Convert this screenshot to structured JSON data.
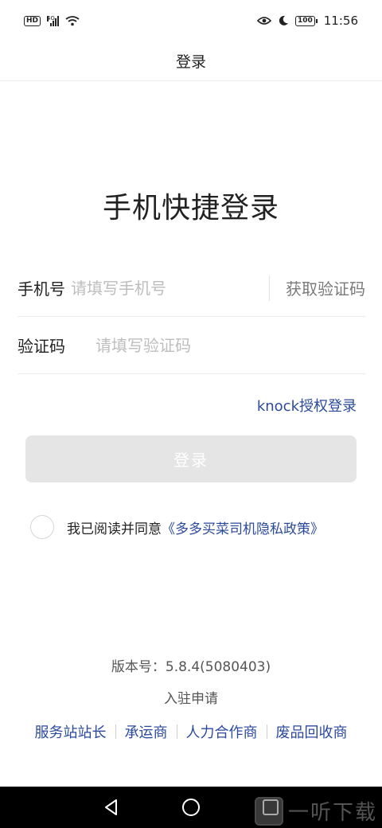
{
  "status_bar": {
    "hd": "HD",
    "network": "4G",
    "battery": "100",
    "time": "11:56"
  },
  "header": {
    "title": "登录"
  },
  "login_title": "手机快捷登录",
  "form": {
    "phone_label": "手机号",
    "phone_placeholder": "请填写手机号",
    "get_code_label": "获取验证码",
    "code_label": "验证码",
    "code_placeholder": "请填写验证码"
  },
  "knock_link": "knock授权登录",
  "login_button": "登录",
  "agreement": {
    "text": "我已阅读并同意",
    "link": "《多多买菜司机隐私政策》"
  },
  "version": "版本号：5.8.4(5080403)",
  "apply_label": "入驻申请",
  "role_links": [
    "服务站站长",
    "承运商",
    "人力合作商",
    "废品回收商"
  ],
  "watermark": "一听下载",
  "colors": {
    "link": "#2b4a9c",
    "button_disabled": "#e5e5e5",
    "placeholder": "#bdbdbd"
  }
}
